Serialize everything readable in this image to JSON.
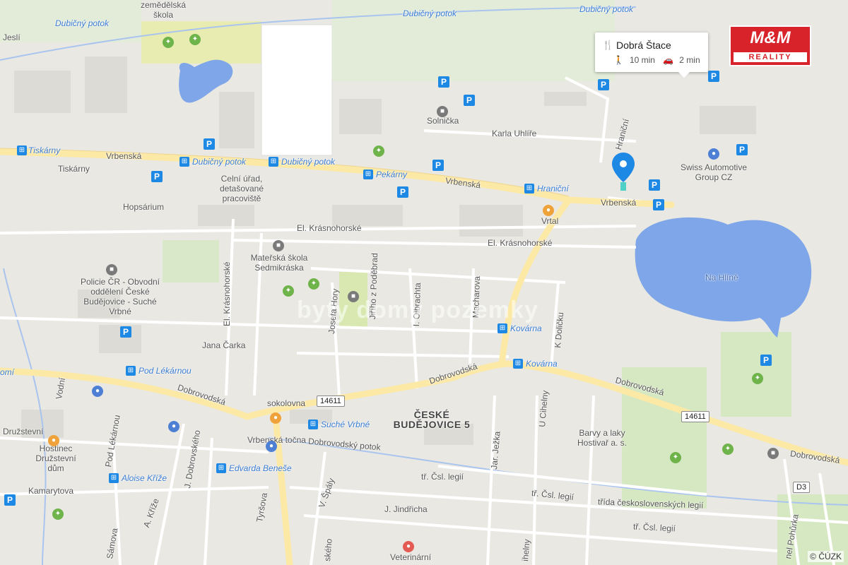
{
  "colors": {
    "water": "#7ea6e8",
    "major_road": "#fde9a6",
    "road": "#ffffff",
    "park": "#cfe8b4",
    "parking": "#1e88e5",
    "background": "#e9e8e3"
  },
  "popup": {
    "title": "Dobrá Štace",
    "walk": "10 min",
    "drive": "2 min",
    "icons": [
      "restaurant-icon",
      "walk-icon",
      "car-icon"
    ]
  },
  "logo": {
    "top": "M&M",
    "bottom": "REALITY"
  },
  "copyright": "© ČÚZK",
  "watermark": "byty domy pozemky",
  "streets": {
    "vrbenska_w": "Vrbenská",
    "vrbenska_c": "Vrbenská",
    "vrbenska_e": "Vrbenská",
    "dubicny_potok_n": "Dubičný potok",
    "dubicny_potok_ne": "Dubičný potok",
    "dubicny_potok_nw": "Dubičný potok",
    "karla_uhlire": "Karla Uhlíře",
    "hranicni": "Hraniční",
    "el_krasnohorske_c": "El. Krásnohorské",
    "el_krasnohorske_e": "El. Krásnohorské",
    "el_krasnohorske_v": "El. Krásnohorské",
    "jana_carka": "Jana Čarka",
    "josefa_hory": "Josefa Hory",
    "jiriho_podebrad": "Jiřího z Poděbrad",
    "i_olbrachta": "I. Olbrachta",
    "macharova": "Macharova",
    "k_dolicku": "K Doličku",
    "dobrovodska_w": "Dobrovodská",
    "dobrovodska_c": "Dobrovodská",
    "dobrovodska_e": "Dobrovodská",
    "dobrovodska_far": "Dobrovodská",
    "dobrovodsky_potok": "Dobrovodský potok",
    "tr_csl_legii_1": "tř. Čsl. legií",
    "tr_csl_legii_2": "tř. Čsl. legií",
    "tr_csl_legii_3": "tř. Čsl. legií",
    "trida_ceskoslovenskych": "třída československých legií",
    "vodni": "Vodní",
    "druzstevni": "Družstevní",
    "kamarytova": "Kamarytova",
    "pod_lekarnou_st": "Pod Lékárnou",
    "j_dobrovskeho": "J. Dobrovského",
    "a_krize": "A. Kříže",
    "samova": "Sámova",
    "tyrsova": "Tyršova",
    "v_spaly": "V. Špály",
    "j_jindricha": "J. Jindřicha",
    "jar_jezka": "Jar. Ježka",
    "u_cihelny": "U Cihelny",
    "nel_pohurka": "nel Pohůrka",
    "dobrovskeho_s": "ského",
    "cihelny_s": "ihelny",
    "jesli": "Jeslí"
  },
  "places": {
    "zemedelska_skola": "zemědělská škola",
    "solnicka": "Solnička",
    "celni_urad": "Celní úřad, detašované pracoviště",
    "hopsarium": "Hopsárium",
    "vrtal": "Vrtal",
    "swiss": "Swiss Automotive Group CZ",
    "na_hline": "Na Hlíně",
    "ms_sedmikraska": "Mateřská škola Sedmikráska",
    "policie": "Policie ČR - Obvodní oddělení České Budějovice - Suché Vrbné",
    "sokolovna": "sokolovna",
    "vrbenska_tocna": "Vrbenská točna",
    "ceske_budejovice_5": "ČESKÉ BUDĚJOVICE 5",
    "barvy": "Barvy a laky Hostivař a. s.",
    "hostinec": "Hostinec Družstevní dům",
    "veterinarni": "Veterinární"
  },
  "stops": {
    "tiskarny": "Tiskárny",
    "tiskarny_label": "Tiskárny",
    "dubicny_potok_1": "Dubičný potok",
    "dubicny_potok_2": "Dubičný potok",
    "pekarny": "Pekárny",
    "hranicni": "Hraniční",
    "kovarna_1": "Kovárna",
    "kovarna_2": "Kovárna",
    "pod_lekarnou": "Pod Lékárnou",
    "suche_vrbne": "Suché Vrbné",
    "edvarda_benese": "Edvarda Beneše",
    "aloise_krize": "Aloise Kříže",
    "omi": "omí"
  },
  "routes": {
    "r14611_a": "14611",
    "r14611_b": "14611",
    "d3": "D3"
  },
  "parking_label": "P",
  "bus_label": "⊞",
  "poi_icons": [
    "park-icon",
    "school-icon",
    "hotel-icon",
    "fuel-icon",
    "car-repair-icon",
    "shop-icon",
    "vet-icon",
    "museum-icon",
    "playground-icon"
  ]
}
